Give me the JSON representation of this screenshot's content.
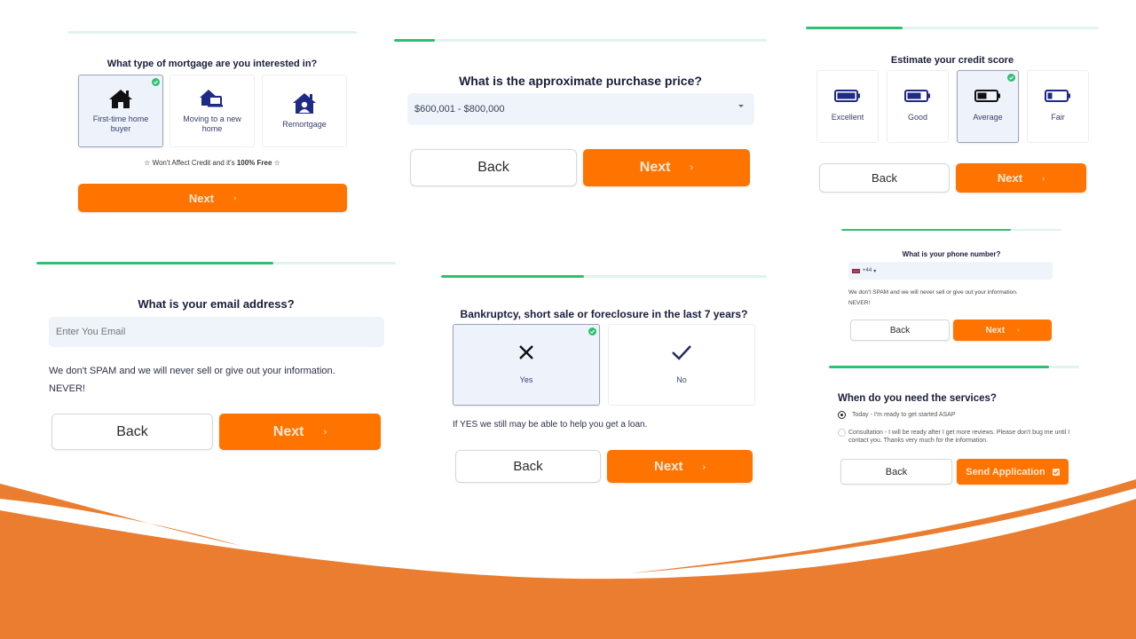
{
  "theme": {
    "accent": "#ff7300",
    "progress_fill": "#2fbf71",
    "progress_track": "#dff4ea",
    "selected_bg": "#eef3fb",
    "icon_navy": "#1f2a86",
    "wave": "#ea7d30"
  },
  "panels": {
    "mortgage_type": {
      "progress": 0.0,
      "title": "What type of mortgage are you interested in?",
      "options": [
        {
          "label": "First-time home buyer",
          "icon": "house-icon",
          "selected": true
        },
        {
          "label": "Moving to a new home",
          "icon": "house-laptop-icon",
          "selected": false
        },
        {
          "label": "Remortgage",
          "icon": "house-user-icon",
          "selected": false
        }
      ],
      "note_prefix": "☆ Won't Affect Credit and it's ",
      "note_bold": "100% Free",
      "note_suffix": " ☆",
      "next_label": "Next",
      "chevron": "›"
    },
    "purchase_price": {
      "progress": 0.11,
      "title": "What is the approximate purchase price?",
      "select_value": "$600,001 - $800,000",
      "back_label": "Back",
      "next_label": "Next",
      "chevron": "›"
    },
    "credit_score": {
      "progress": 0.33,
      "title": "Estimate your credit score",
      "options": [
        {
          "label": "Excellent",
          "icon": "battery-full-icon",
          "level": 1.0,
          "selected": false
        },
        {
          "label": "Good",
          "icon": "battery-three-quarters-icon",
          "level": 0.75,
          "selected": false
        },
        {
          "label": "Average",
          "icon": "battery-half-icon",
          "level": 0.5,
          "selected": true
        },
        {
          "label": "Fair",
          "icon": "battery-quarter-icon",
          "level": 0.25,
          "selected": false
        }
      ],
      "back_label": "Back",
      "next_label": "Next",
      "chevron": "›"
    },
    "email": {
      "progress": 0.66,
      "title": "What is your email address?",
      "input_placeholder": "Enter You Email",
      "input_value": "",
      "note_line1": "We don't SPAM and we will never sell or give out your information.",
      "note_line2": "NEVER!",
      "back_label": "Back",
      "next_label": "Next",
      "chevron": "›"
    },
    "bankruptcy": {
      "progress": 0.44,
      "title": "Bankruptcy, short sale or foreclosure in the last 7 years?",
      "options": [
        {
          "label": "Yes",
          "icon": "x-icon",
          "selected": true
        },
        {
          "label": "No",
          "icon": "checkmark-icon",
          "selected": false
        }
      ],
      "note": "If YES we still may be able to help you get a loan.",
      "back_label": "Back",
      "next_label": "Next",
      "chevron": "›"
    },
    "phone": {
      "progress": 0.77,
      "title": "What is your phone number?",
      "country_code": "+44",
      "flag": "uk-flag-icon",
      "input_value": "",
      "note_line1": "We don't SPAM and we will never sell or give out your information.",
      "note_line2": "NEVER!",
      "back_label": "Back",
      "next_label": "Next",
      "chevron": "›"
    },
    "services": {
      "progress": 0.88,
      "title": "When do you need the services?",
      "options": [
        {
          "label": "Today - I'm ready to get started ASAP",
          "selected": true
        },
        {
          "label": "Consultation - I will be ready after I get more reviews. Please don't bug me until I contact you. Thanks very much for the information.",
          "selected": false
        }
      ],
      "back_label": "Back",
      "send_label": "Send Application"
    }
  }
}
